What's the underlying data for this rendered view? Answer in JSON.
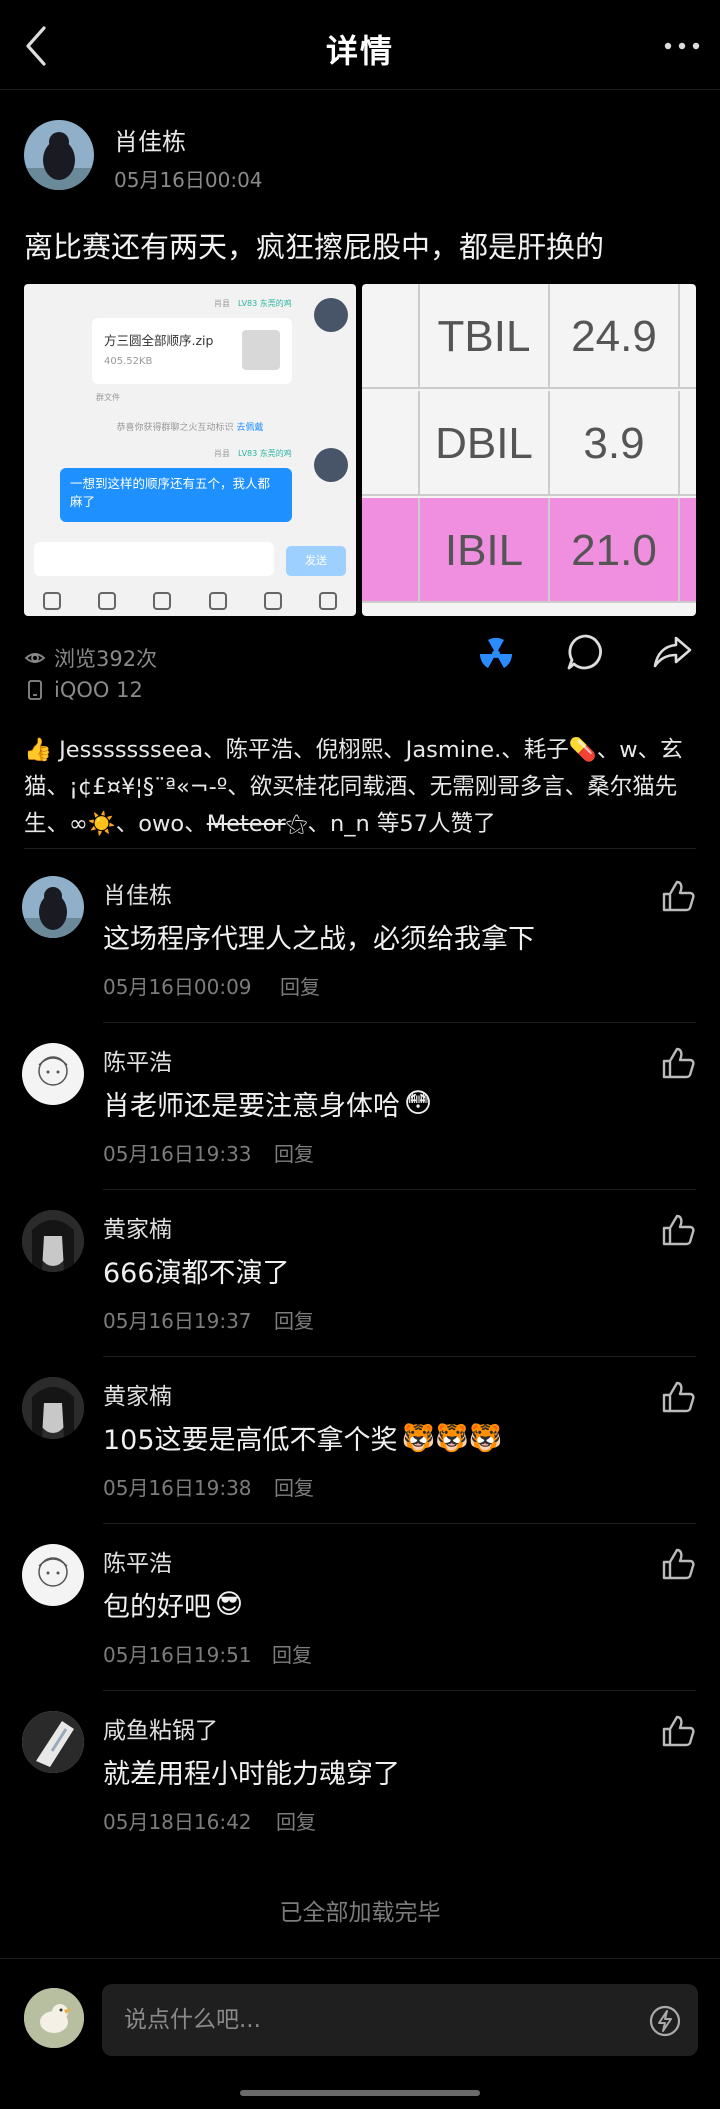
{
  "header": {
    "title": "详情"
  },
  "post": {
    "author": "肖佳栋",
    "time": "05月16日00:04",
    "text": "离比赛还有两天，疯狂擦屁股中，都是肝换的",
    "image_left": {
      "file_name": "方三圆全部顺序.zip",
      "file_size": "405.52KB",
      "tag": "LV83 东莞的鸡",
      "sender": "肖县",
      "sys_text": "群文件",
      "tip_text": "恭喜你获得群聊之火互动标识",
      "tip_link": "去佩戴",
      "bubble_text": "一想到这样的顺序还有五个，我人都麻了",
      "send_label": "发送"
    },
    "image_right": {
      "rows": [
        {
          "label": "TBIL",
          "value": "24.9"
        },
        {
          "label": "DBIL",
          "value": "3.9"
        },
        {
          "label": "IBIL",
          "value": "21.0"
        }
      ]
    },
    "views": "浏览392次",
    "device": "iQOO 12"
  },
  "likes": {
    "names_before": "Jessssssseea、陈平浩、倪栩熙、Jasmine.、耗子💊、w、玄猫、¡¢£¤¥¦§¨ª«¬-º、欲买桂花同载酒、无需刚哥多言、桑尔猫先生、∞☀️、owo、",
    "strike_name": "Meteor",
    "names_after": "⚝、n_n 等57人赞了"
  },
  "reply_label": "回复",
  "comments": [
    {
      "name": "肖佳栋",
      "text": "这场程序代理人之战，必须给我拿下",
      "emoji": "",
      "time": "05月16日00:09"
    },
    {
      "name": "陈平浩",
      "text": "肖老师还是要注意身体哈",
      "emoji": "😳",
      "time": "05月16日19:33"
    },
    {
      "name": "黄家楠",
      "text": "666演都不演了",
      "emoji": "",
      "time": "05月16日19:37"
    },
    {
      "name": "黄家楠",
      "text": "105这要是高低不拿个奖",
      "emoji": "🐯🐯🐯",
      "time": "05月16日19:38"
    },
    {
      "name": "陈平浩",
      "text": "包的好吧",
      "emoji": "😎",
      "time": "05月16日19:51"
    },
    {
      "name": "咸鱼粘锅了",
      "text": "就差用程小时能力魂穿了",
      "emoji": "",
      "time": "05月18日16:42"
    }
  ],
  "end_text": "已全部加载完毕",
  "comment_input": {
    "placeholder": "说点什么吧..."
  },
  "colors": {
    "background": "#000000",
    "accent_blue": "#1e90ff",
    "text_secondary": "#8a8a8a"
  }
}
